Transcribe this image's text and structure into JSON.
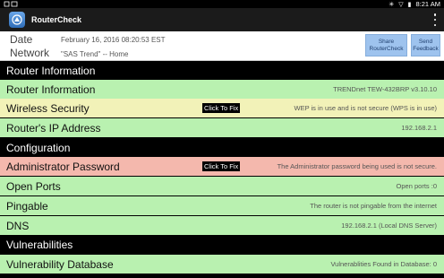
{
  "statusbar": {
    "clock": "8:21 AM",
    "icons": [
      "bluetooth-icon",
      "wifi-icon",
      "battery-icon"
    ],
    "left_icons": [
      "wifi-icon",
      "rectangle-icon"
    ]
  },
  "appbar": {
    "title": "RouterCheck",
    "icon": "router-icon"
  },
  "info": {
    "date_label": "Date",
    "date_value": "February 16, 2016   08:20:53 EST",
    "network_label": "Network",
    "network_value": "\"SAS Trend\"  -- Home",
    "share_label": "Share RouterCheck",
    "send_label": "Send Feedback"
  },
  "sections": {
    "router_info": "Router Information",
    "configuration": "Configuration",
    "vulnerabilities": "Vulnerabilities"
  },
  "rows": {
    "router_information": {
      "label": "Router Information",
      "value": "TRENDnet  TEW-432BRP  v3.10.10"
    },
    "wireless_security": {
      "label": "Wireless Security",
      "fix": "Click To Fix",
      "value": "WEP is in use and is not secure (WPS is in use)"
    },
    "router_ip": {
      "label": "Router's IP Address",
      "value": "192.168.2.1"
    },
    "admin_password": {
      "label": "Administrator Password",
      "fix": "Click To Fix",
      "value": "The Administrator password being used is not secure."
    },
    "open_ports": {
      "label": "Open Ports",
      "value": "Open ports :0"
    },
    "pingable": {
      "label": "Pingable",
      "value": "The router is not pingable from the internet"
    },
    "dns": {
      "label": "DNS",
      "value": "192.168.2.1 (Local DNS Server)"
    },
    "vuln_db": {
      "label": "Vulnerability Database",
      "value": "Vulnerablities Found in Database: 0"
    }
  },
  "colors": {
    "ok": "#b9f1b0",
    "warning": "#f2f2b8",
    "danger": "#f4b8ad",
    "button": "#9ec3ee"
  }
}
